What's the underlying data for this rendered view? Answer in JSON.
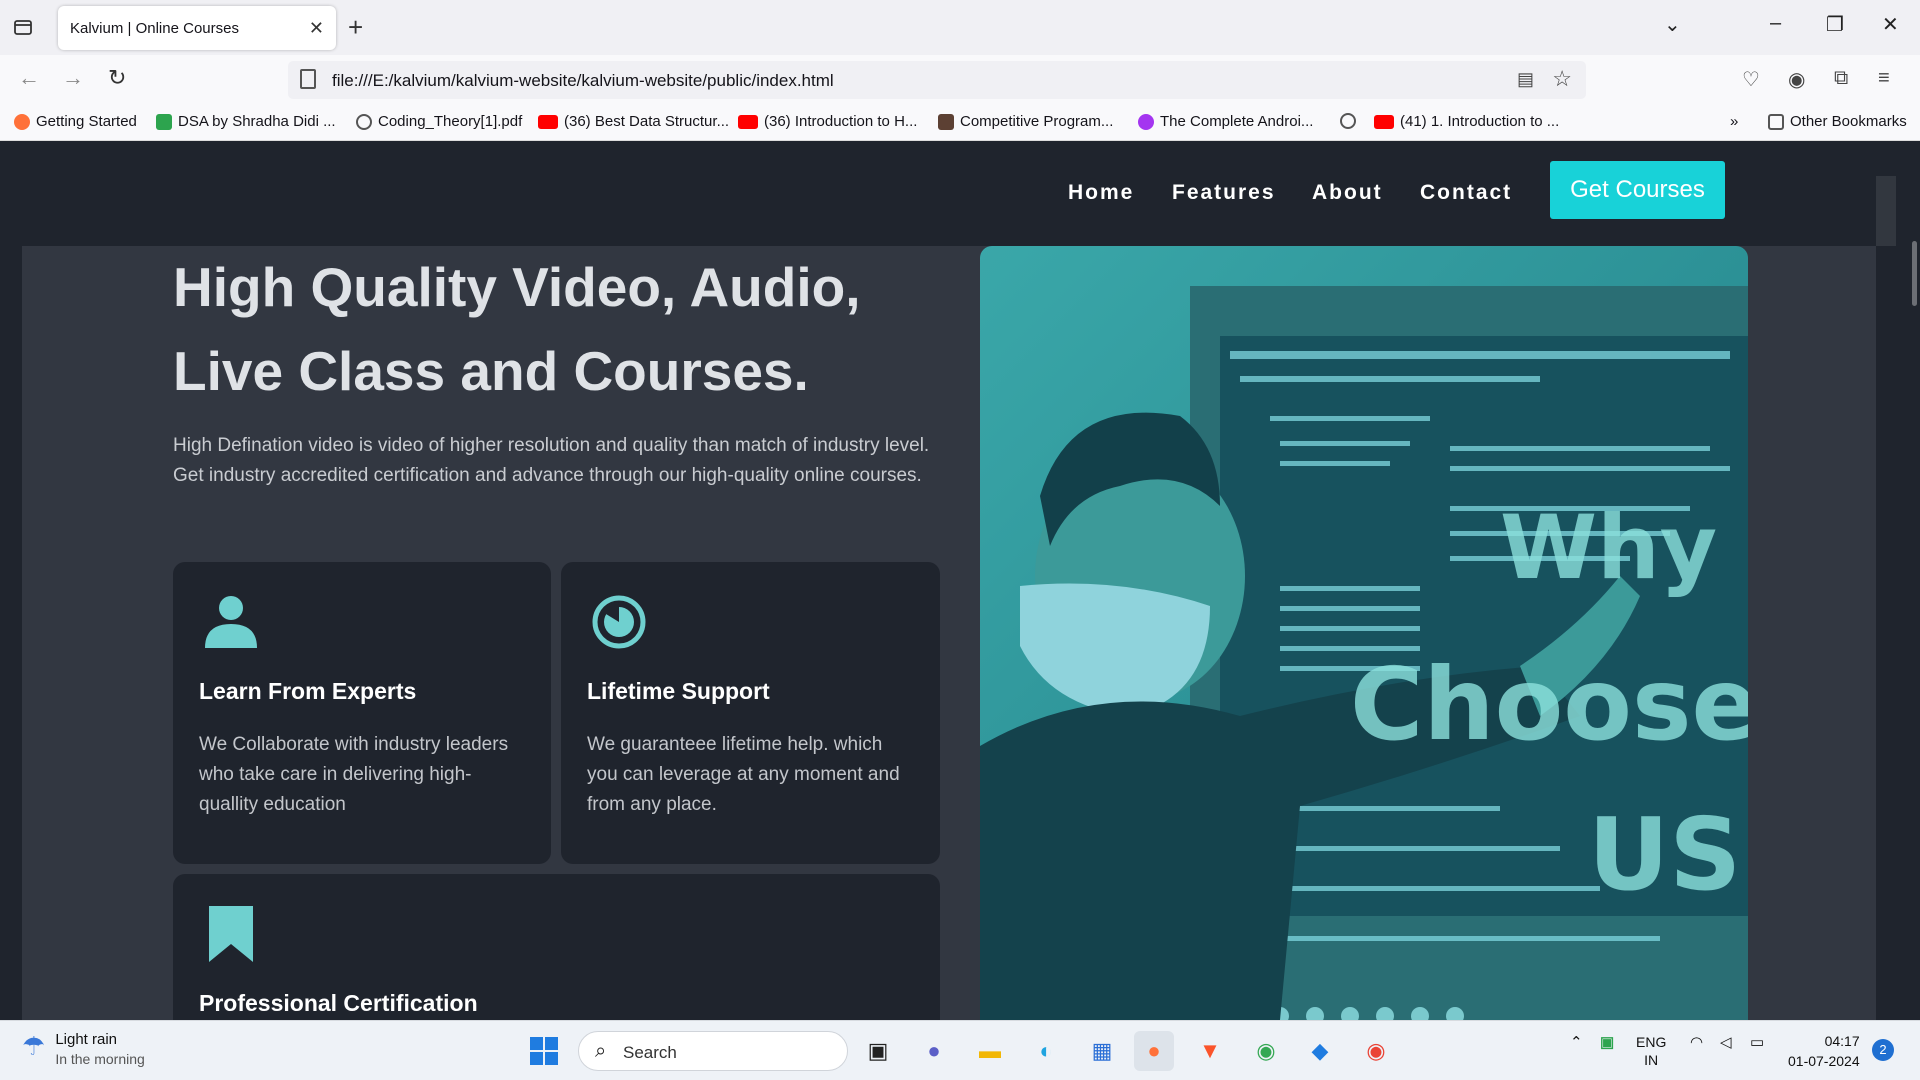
{
  "browser": {
    "tab_title": "Kalvium | Online Courses",
    "url": "file:///E:/kalvium/kalvium-website/kalvium-website/public/index.html",
    "bookmarks": [
      {
        "label": "Getting Started",
        "color": "#ff7139"
      },
      {
        "label": "DSA by Shradha Didi ...",
        "color": "#2da44e"
      },
      {
        "label": "Coding_Theory[1].pdf",
        "color": "#555555"
      },
      {
        "label": "(36) Best Data Structur...",
        "color": "#ff0000"
      },
      {
        "label": "(36) Introduction to H...",
        "color": "#ff0000"
      },
      {
        "label": "Competitive Program...",
        "color": "#5c4033"
      },
      {
        "label": "The Complete Androi...",
        "color": "#a435f0"
      },
      {
        "label": "",
        "color": "#555555"
      },
      {
        "label": "(41) 1. Introduction to ...",
        "color": "#ff0000"
      }
    ],
    "other_bookmarks": "Other Bookmarks"
  },
  "site": {
    "nav": [
      "Home",
      "Features",
      "About",
      "Contact"
    ],
    "cta_label": "Get Courses",
    "hero_title": "High Quality Video, Audio, Live Class and Courses.",
    "hero_text": "High Defination video is video of higher resolution and quality than match of industry level. Get industry accredited certification and advance through our high-quality online courses.",
    "features": [
      {
        "icon": "person-icon",
        "title": "Learn From Experts",
        "text": "We Collaborate with industry leaders who take care in delivering high-quallity education"
      },
      {
        "icon": "clock-icon",
        "title": "Lifetime Support",
        "text": "We guaranteee lifetime help. which you can leverage at any moment and from any place."
      },
      {
        "icon": "bookmark-icon",
        "title": "Professional Certification",
        "text": ""
      }
    ],
    "why_words": [
      "Why",
      "Choose",
      "US"
    ],
    "accent": "#18d2d8",
    "icon_color": "#6fd0cf"
  },
  "taskbar": {
    "weather_main": "Light rain",
    "weather_sub": "In the morning",
    "search_label": "Search",
    "lang_top": "ENG",
    "lang_bottom": "IN",
    "time": "04:17",
    "date": "01-07-2024",
    "notifications": "2"
  }
}
